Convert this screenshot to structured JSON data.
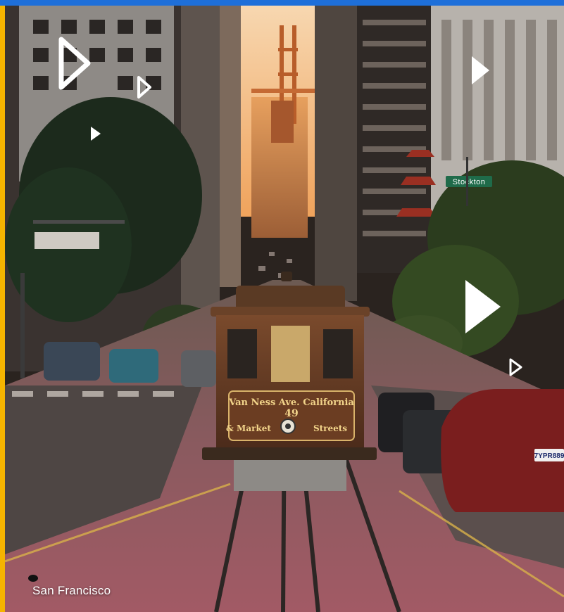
{
  "caption": "San Francisco",
  "street_sign": "Stockton",
  "tram": {
    "line1": "Van Ness Ave. California",
    "number": "49",
    "line2_left": "& Market",
    "line2_right": "Streets"
  },
  "license_plate": "7YPR889",
  "colors": {
    "top_bar": "#1e6fd9",
    "left_bar": "#f5b400",
    "play_icon": "#ffffff"
  }
}
